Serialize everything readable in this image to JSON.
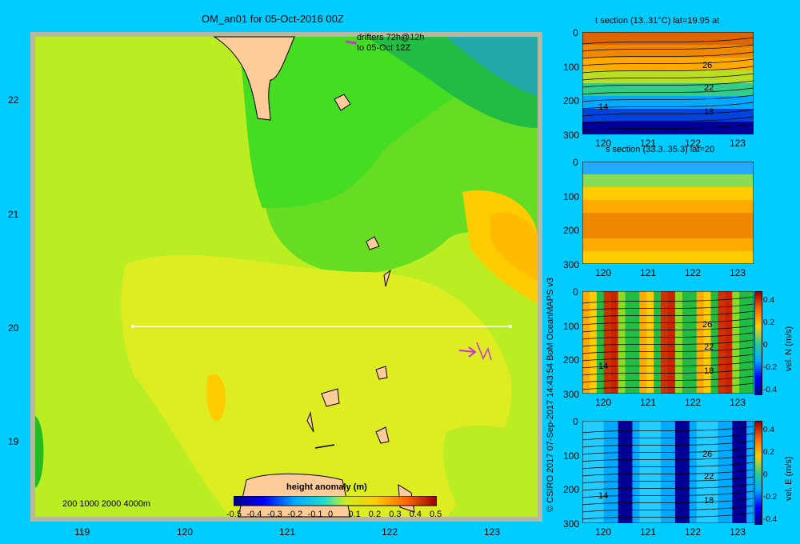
{
  "main_map": {
    "title": "OM_an01 for 05-Oct-2016 00Z",
    "drifters_line1": "drifters 72h@12h",
    "drifters_line2": "to 05-Oct 12Z",
    "depth_legend": "200  1000  2000  4000m",
    "colorbar_title": "height anomaly (m)",
    "colorbar_ticks": [
      "-0.5",
      "-0.4",
      "-0.3",
      "-0.2",
      "-0.1",
      "0",
      "0.1",
      "0.2",
      "0.3",
      "0.4",
      "0.5"
    ],
    "x_ticks": [
      "119",
      "120",
      "121",
      "122",
      "123"
    ],
    "y_ticks": [
      "22",
      "21",
      "20",
      "19"
    ],
    "section_lat": 20
  },
  "credit": "© CSIRO 2017   07-Sep-2017 14:43:54 BoM OceanMAPS v3",
  "sections": [
    {
      "title": "t section (13..31°C) lat=19.95 at",
      "contours": [
        "26",
        "22",
        "18",
        "14"
      ]
    },
    {
      "title": "s section (33.3..35.3) lat=20",
      "contours": []
    },
    {
      "title": "",
      "cbar_label": "vel. N (m/s)",
      "contours": [
        "26",
        "22",
        "18",
        "14"
      ]
    },
    {
      "title": "",
      "cbar_label": "vel. E (m/s)",
      "contours": [
        "26",
        "22",
        "18",
        "14"
      ]
    }
  ],
  "section_y_ticks": [
    "0",
    "100",
    "200",
    "300"
  ],
  "section_x_ticks": [
    "120",
    "121",
    "122",
    "123"
  ],
  "vel_ticks": [
    "0.4",
    "0.2",
    "0",
    "-0.2",
    "-0.4"
  ],
  "chart_data": [
    {
      "type": "heatmap",
      "title": "OM_an01 for 05-Oct-2016 00Z",
      "variable": "height anomaly (m)",
      "x_range": [
        118.5,
        123.5
      ],
      "y_range": [
        18.3,
        22.6
      ],
      "x_ticks": [
        119,
        120,
        121,
        122,
        123
      ],
      "y_ticks": [
        19,
        20,
        21,
        22
      ],
      "color_range": [
        -0.5,
        0.5
      ],
      "section_line": {
        "lat": 20,
        "lon_start": 119.5,
        "lon_end": 123.2
      }
    },
    {
      "type": "heatmap",
      "title": "t section (13..31°C) lat=19.95 at",
      "y_range": [
        0,
        300
      ],
      "x_range": [
        119.6,
        123.2
      ],
      "contour_labels": [
        26,
        22,
        18,
        14
      ]
    },
    {
      "type": "heatmap",
      "title": "s section (33.3..35.3) lat=20",
      "y_range": [
        0,
        300
      ],
      "x_range": [
        119.6,
        123.2
      ]
    },
    {
      "type": "heatmap",
      "variable": "vel. N (m/s)",
      "y_range": [
        0,
        300
      ],
      "x_range": [
        119.6,
        123.2
      ],
      "color_range": [
        -0.4,
        0.4
      ]
    },
    {
      "type": "heatmap",
      "variable": "vel. E (m/s)",
      "y_range": [
        0,
        300
      ],
      "x_range": [
        119.6,
        123.2
      ],
      "color_range": [
        -0.4,
        0.4
      ]
    }
  ]
}
